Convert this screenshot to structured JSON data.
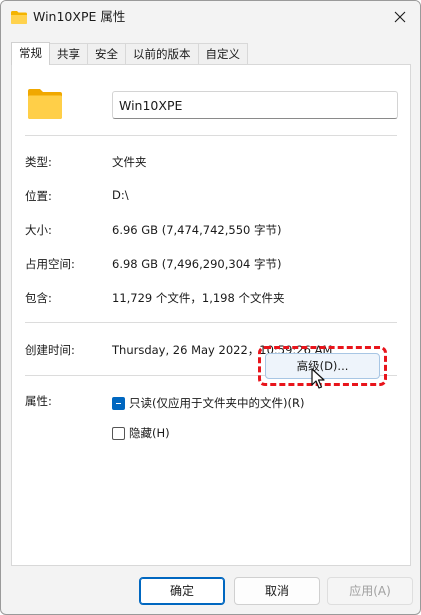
{
  "window": {
    "title": "Win10XPE 属性",
    "close_icon": "close-icon"
  },
  "tabs": [
    {
      "label": "常规",
      "active": true
    },
    {
      "label": "共享",
      "active": false
    },
    {
      "label": "安全",
      "active": false
    },
    {
      "label": "以前的版本",
      "active": false
    },
    {
      "label": "自定义",
      "active": false
    }
  ],
  "general": {
    "folder_icon": "folder-icon",
    "name_value": "Win10XPE",
    "rows": [
      {
        "label": "类型:",
        "value": "文件夹"
      },
      {
        "label": "位置:",
        "value": "D:\\"
      },
      {
        "label": "大小:",
        "value": "6.96 GB (7,474,742,550 字节)"
      },
      {
        "label": "占用空间:",
        "value": "6.98 GB (7,496,290,304 字节)"
      },
      {
        "label": "包含:",
        "value": "11,729 个文件，1,198 个文件夹"
      }
    ],
    "created_label": "创建时间:",
    "created_value": "Thursday, 26 May 2022，10:59:26 AM",
    "attributes_label": "属性:",
    "readonly_label": "只读(仅应用于文件夹中的文件)(R)",
    "readonly_state": "indeterminate",
    "hidden_label": "隐藏(H)",
    "hidden_state": "unchecked",
    "advanced_label": "高级(D)..."
  },
  "footer": {
    "ok_label": "确定",
    "cancel_label": "取消",
    "apply_label": "应用(A)"
  },
  "colors": {
    "accent": "#0067c0",
    "highlight": "#e8141b",
    "folder": "#f8c13a"
  }
}
